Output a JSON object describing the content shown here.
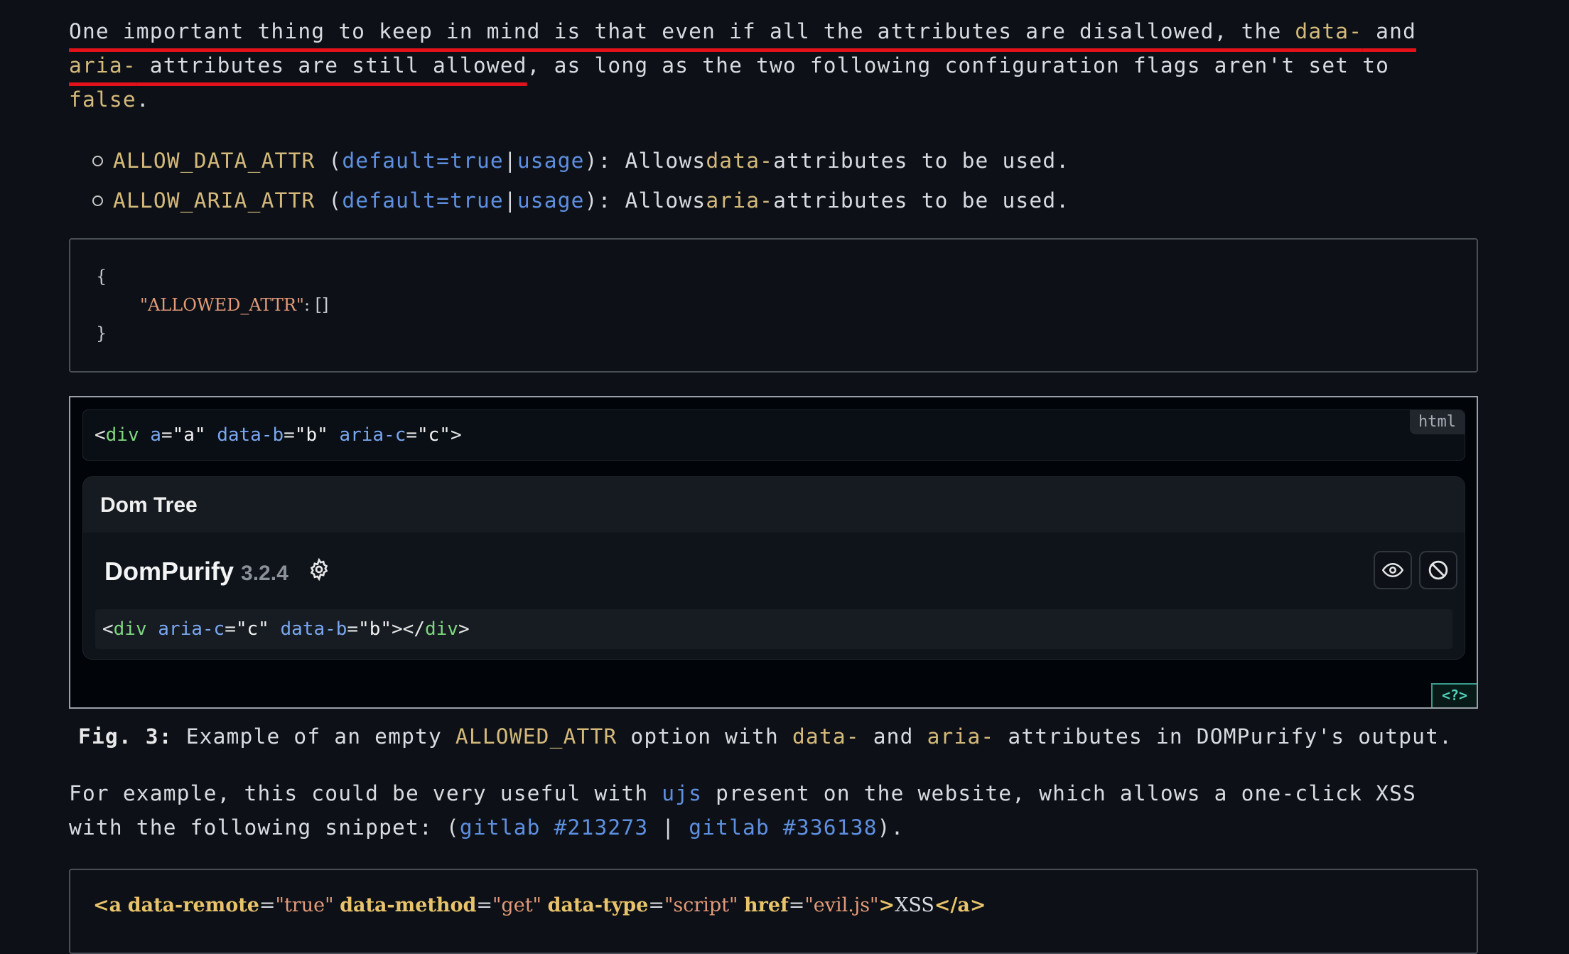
{
  "para1": {
    "u1": "One important thing to keep in mind is that even if all the attributes are disallowed, the ",
    "u1_kw": "data-",
    "u1_and": " and",
    "u2_kw": "aria-",
    "u2": " attributes are still allowed",
    "rest": ", as long as the two following configuration flags aren't set to",
    "last": "false",
    "dot": "."
  },
  "bullets": [
    {
      "name": "ALLOW_DATA_ATTR",
      "default": "default=true",
      "sep": " | ",
      "usage": "usage",
      "pre": "): Allows ",
      "kw": "data-",
      "post": " attributes to be used."
    },
    {
      "name": "ALLOW_ARIA_ATTR",
      "default": "default=true",
      "sep": " | ",
      "usage": "usage",
      "pre": "): Allows ",
      "kw": "aria-",
      "post": " attributes to be used."
    }
  ],
  "config_code": {
    "open": "{",
    "key": "\"ALLOWED_ATTR\"",
    "value": ": []",
    "close": "}"
  },
  "demo": {
    "lang": "html",
    "input": {
      "tag": "div",
      "attrs": [
        {
          "name": "a",
          "value": "\"a\""
        },
        {
          "name": "data-b",
          "value": "\"b\""
        },
        {
          "name": "aria-c",
          "value": "\"c\""
        }
      ]
    },
    "dom_tree_title": "Dom Tree",
    "library": "DomPurify",
    "version": "3.2.4",
    "output": {
      "tag": "div",
      "attrs": [
        {
          "name": "aria-c",
          "value": "\"c\""
        },
        {
          "name": "data-b",
          "value": "\"b\""
        }
      ]
    },
    "toggle_label": "<?>"
  },
  "caption": {
    "label": "Fig. 3:",
    "t1": " Example of an empty ",
    "kw1": "ALLOWED_ATTR",
    "t2": " option with ",
    "kw2": "data-",
    "t3": " and ",
    "kw3": "aria-",
    "t4": " attributes in DOMPurify's output."
  },
  "para2": {
    "t1": "For example, this could be very useful with ",
    "link1": "ujs",
    "t2": " present on the website, which allows a one-click XSS",
    "t3": "with the following snippet: (",
    "link2": "gitlab #213273",
    "sep": " | ",
    "link3": "gitlab #336138",
    "t4": ")."
  },
  "snippet": {
    "open": "<a",
    "a1": "data-remote",
    "v1": "\"true\"",
    "a2": "data-method",
    "v2": "\"get\"",
    "a3": "data-type",
    "v3": "\"script\"",
    "a4": "href",
    "v4": "\"evil.js\"",
    "gt": ">",
    "text": "XSS",
    "close": "</a>"
  }
}
